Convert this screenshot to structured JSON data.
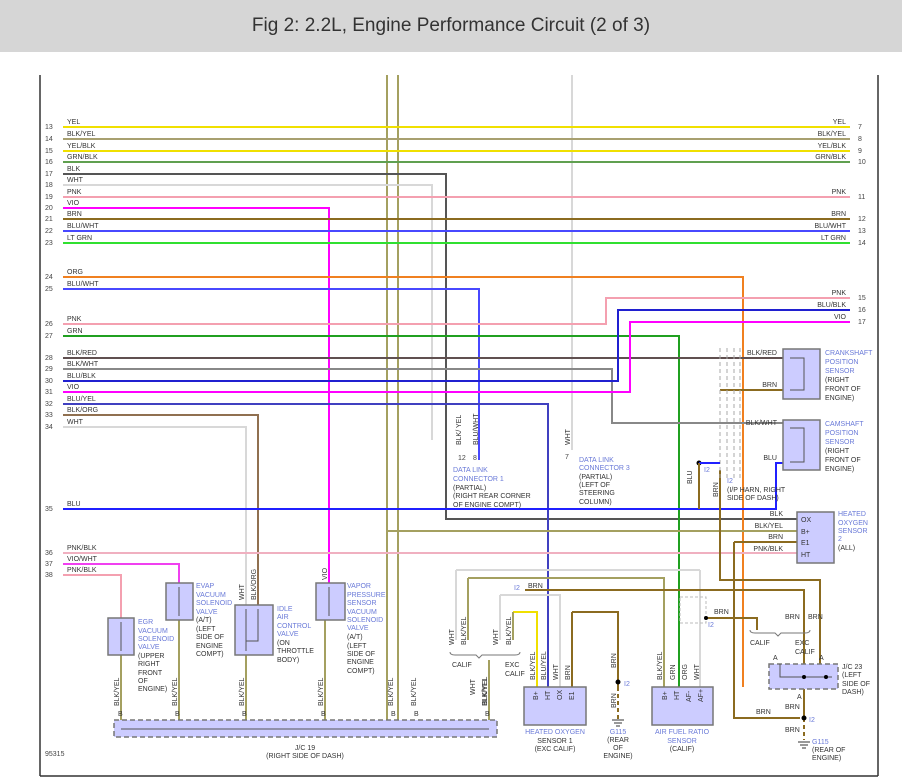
{
  "title": "Fig 2: 2.2L, Engine Performance Circuit (2 of 3)",
  "left_wires": [
    {
      "num": "13",
      "color": "YEL"
    },
    {
      "num": "14",
      "color": "BLK/YEL"
    },
    {
      "num": "15",
      "color": "YEL/BLK"
    },
    {
      "num": "16",
      "color": "GRN/BLK"
    },
    {
      "num": "17",
      "color": "BLK"
    },
    {
      "num": "18",
      "color": "WHT"
    },
    {
      "num": "19",
      "color": "PNK"
    },
    {
      "num": "20",
      "color": "VIO"
    },
    {
      "num": "21",
      "color": "BRN"
    },
    {
      "num": "22",
      "color": "BLU/WHT"
    },
    {
      "num": "23",
      "color": "LT GRN"
    },
    {
      "num": "24",
      "color": "ORG"
    },
    {
      "num": "25",
      "color": "BLU/WHT"
    },
    {
      "num": "26",
      "color": "PNK"
    },
    {
      "num": "27",
      "color": "GRN"
    },
    {
      "num": "28",
      "color": "BLK/RED"
    },
    {
      "num": "29",
      "color": "BLK/WHT"
    },
    {
      "num": "30",
      "color": "BLU/BLK"
    },
    {
      "num": "31",
      "color": "VIO"
    },
    {
      "num": "32",
      "color": "BLU/YEL"
    },
    {
      "num": "33",
      "color": "BLK/ORG"
    },
    {
      "num": "34",
      "color": "WHT"
    },
    {
      "num": "35",
      "color": "BLU"
    },
    {
      "num": "36",
      "color": "PNK/BLK"
    },
    {
      "num": "37",
      "color": "VIO/WHT"
    },
    {
      "num": "38",
      "color": "PNK/BLK"
    }
  ],
  "right_wires": [
    {
      "num": "7",
      "color": "YEL"
    },
    {
      "num": "8",
      "color": "BLK/YEL"
    },
    {
      "num": "9",
      "color": "YEL/BLK"
    },
    {
      "num": "10",
      "color": "GRN/BLK"
    },
    {
      "num": "11",
      "color": "PNK"
    },
    {
      "num": "12",
      "color": "BRN"
    },
    {
      "num": "13",
      "color": "BLU/WHT"
    },
    {
      "num": "14",
      "color": "LT GRN"
    },
    {
      "num": "15",
      "color": "PNK"
    },
    {
      "num": "16",
      "color": "BLU/BLK"
    },
    {
      "num": "17",
      "color": "VIO"
    }
  ],
  "components": {
    "crank": {
      "lines": [
        "CRANKSHAFT",
        "POSITION",
        "SENSOR",
        "(RIGHT",
        "FRONT OF",
        "ENGINE)"
      ],
      "w1": "BLK/RED",
      "w2": "BRN"
    },
    "cam": {
      "lines": [
        "CAMSHAFT",
        "POSITION",
        "SENSOR",
        "(RIGHT",
        "FRONT OF",
        "ENGINE)"
      ],
      "w1": "BLK/WHT",
      "w2": "BLU"
    },
    "dlc1": {
      "lines": [
        "DATA LINK",
        "CONNECTOR 1",
        "(PARTIAL)",
        "(RIGHT REAR CORNER",
        "OF ENGINE COMPT)"
      ],
      "wa": "BLK/ YEL",
      "wb": "BLU/WHT",
      "pa": "12",
      "pb": "8"
    },
    "dlc3": {
      "lines": [
        "DATA LINK",
        "CONNECTOR 3",
        "(PARTIAL)",
        "(LEFT OF",
        "STEERING",
        "COLUMN)"
      ],
      "w": "WHT",
      "p": "7"
    },
    "i2": {
      "id": "I2",
      "lines": [
        "I2",
        "(I/P HARN, RIGHT",
        "SIDE OF DASH)"
      ],
      "blu": "BLU",
      "brn": "BRN"
    },
    "ho2s2": {
      "lines": [
        "HEATED",
        "OXYGEN",
        "SENSOR",
        "2",
        "(ALL)"
      ],
      "pins": [
        "OX",
        "B+",
        "E1",
        "HT"
      ],
      "wires": [
        "BLK",
        "BLK/YEL",
        "BRN",
        "PNK/BLK"
      ]
    },
    "egr": {
      "lines": [
        "EGR",
        "VACUUM",
        "SOLENOID",
        "VALVE",
        "(UPPER",
        "RIGHT",
        "FRONT",
        "OF",
        "ENGINE)"
      ]
    },
    "evap": {
      "lines": [
        "EVAP",
        "VACUUM",
        "SOLENOID",
        "VALVE",
        "(A/T)",
        "(LEFT",
        "SIDE OF",
        "ENGINE",
        "COMPT)"
      ]
    },
    "iac": {
      "lines": [
        "IDLE",
        "AIR",
        "CONTROL",
        "VALVE",
        "(ON",
        "THROTTLE",
        "BODY)"
      ],
      "wa": "WHT",
      "wb": "BLK/ORG"
    },
    "vapor": {
      "lines": [
        "VAPOR",
        "PRESSURE",
        "SENSOR",
        "VACUUM",
        "SOLENOID",
        "VALVE",
        "(A/T)",
        "(LEFT",
        "SIDE OF",
        "ENGINE",
        "COMPT)"
      ],
      "w": "VIO"
    },
    "jc19": {
      "lines": [
        "J/C 19",
        "(RIGHT SIDE OF DASH)"
      ],
      "pin": "B",
      "wire": "BLK/YEL"
    },
    "ho2s1": {
      "lines": [
        "HEATED OXYGEN",
        "SENSOR 1",
        "(EXC CALIF)"
      ],
      "pins": [
        "B+",
        "HT",
        "OX",
        "E1"
      ],
      "wires": [
        "BLK/YEL",
        "BLU/YEL",
        "WHT",
        "BRN"
      ]
    },
    "afr": {
      "lines": [
        "AIR FUEL RATIO",
        "SENSOR",
        "(CALIF)"
      ],
      "pins": [
        "B+",
        "HT",
        "AF-",
        "AF+"
      ],
      "wires": [
        "BLK/YEL",
        "GRN",
        "ORG",
        "WHT"
      ]
    },
    "g115a": {
      "lines": [
        "G115",
        "(REAR",
        "OF",
        "ENGINE)"
      ],
      "wire": "BRN",
      "id": "I2"
    },
    "jc23": {
      "lines": [
        "J/C 23",
        "(LEFT",
        "SIDE OF",
        "DASH)"
      ],
      "pin": "A"
    },
    "g115b": {
      "lines": [
        "G115",
        "(REAR OF",
        "ENGINE)"
      ],
      "wire": "BRN",
      "id": "I2"
    },
    "calif": "CALIF",
    "exc_calif": [
      "EXC",
      "CALIF"
    ],
    "wht": "WHT",
    "blkyel": "BLK/YEL",
    "brn": "BRN"
  },
  "figure_id": "95315"
}
